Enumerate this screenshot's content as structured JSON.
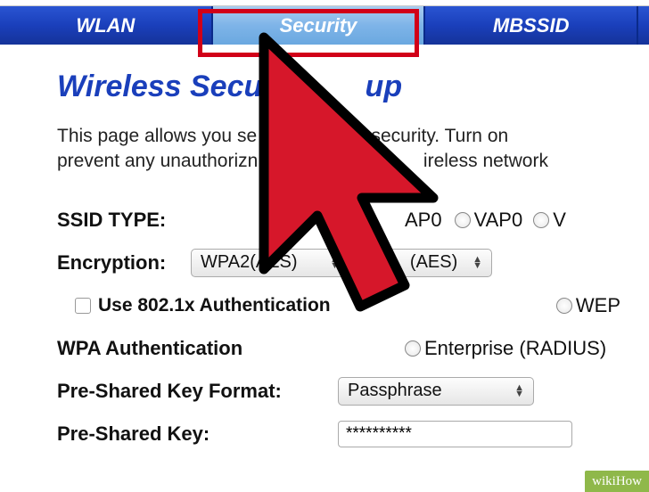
{
  "tabs": {
    "wlan": "WLAN",
    "security": "Security",
    "mbssid": "MBSSID"
  },
  "page": {
    "title_left": "Wireless Securi",
    "title_right": "up",
    "desc_l1a": "This page allows you se",
    "desc_l1b": " security. Turn on",
    "desc_l2a": "prevent any unauthorizn",
    "desc_l2b": "ireless network"
  },
  "form": {
    "ssid_type_label": "SSID TYPE:",
    "ssid_opt_ap0": "AP0",
    "ssid_opt_vap0": "VAP0",
    "ssid_opt_v": "V",
    "encryption_label": "Encryption:",
    "encryption_sel1": "WPA2(AES)",
    "encryption_sel2": "(AES)",
    "use8021x_label": "Use 802.1x Authentication",
    "wep_label": "WEP",
    "wpa_auth_label": "WPA Authentication",
    "wpa_enterprise": "Enterprise (RADIUS)",
    "psk_format_label": "Pre-Shared Key Format:",
    "psk_format_value": "Passphrase",
    "psk_label": "Pre-Shared Key:",
    "psk_value": "**********"
  },
  "watermark": "wikiHow"
}
